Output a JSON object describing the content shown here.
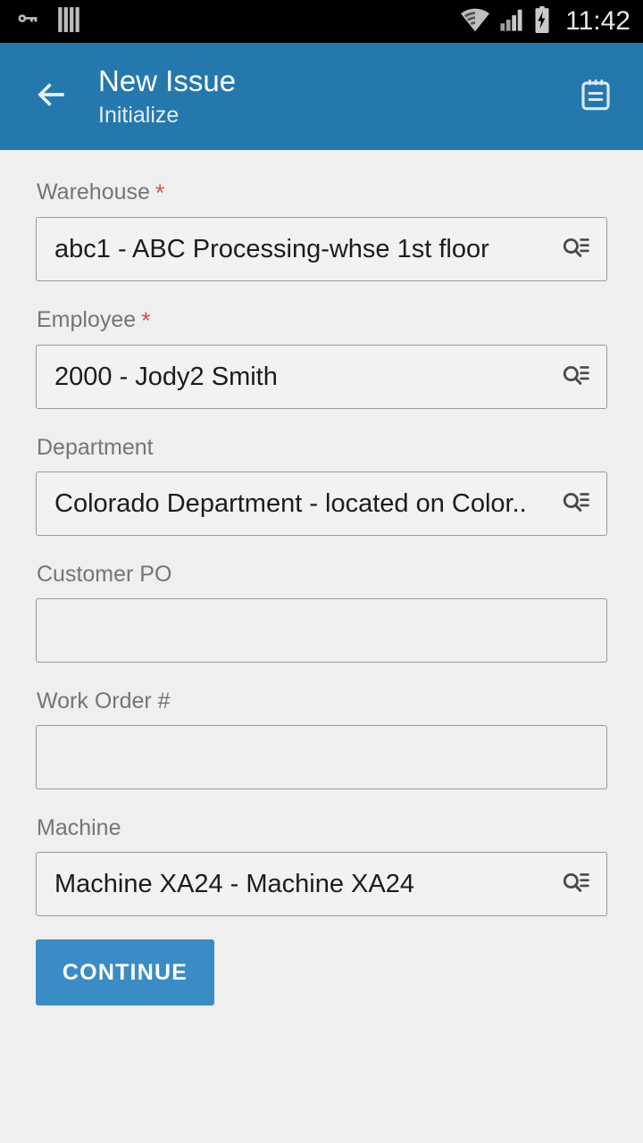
{
  "statusbar": {
    "time": "11:42",
    "left_icons": [
      "vpn-key-icon",
      "barcode-icon"
    ],
    "right_icons": [
      "wifi-icon",
      "cellular-signal-icon",
      "battery-charging-icon"
    ]
  },
  "appbar": {
    "back_icon": "arrow-left-icon",
    "title": "New Issue",
    "subtitle": "Initialize",
    "action_icon": "notepad-icon",
    "background_color": "#2578ae"
  },
  "form": {
    "fields": [
      {
        "label": "Warehouse",
        "required": true,
        "value": "abc1 - ABC Processing-whse 1st floor",
        "placeholder": "",
        "has_lookup": true,
        "name": "warehouse"
      },
      {
        "label": "Employee",
        "required": true,
        "value": "2000 - Jody2 Smith",
        "placeholder": "",
        "has_lookup": true,
        "name": "employee"
      },
      {
        "label": "Department",
        "required": false,
        "value": "Colorado Department - located on Color..",
        "placeholder": "",
        "has_lookup": true,
        "name": "department"
      },
      {
        "label": "Customer PO",
        "required": false,
        "value": "",
        "placeholder": "",
        "has_lookup": false,
        "name": "customer-po"
      },
      {
        "label": "Work Order #",
        "required": false,
        "value": "",
        "placeholder": "",
        "has_lookup": false,
        "name": "work-order-number"
      },
      {
        "label": "Machine",
        "required": false,
        "value": "Machine XA24 - Machine XA24",
        "placeholder": "",
        "has_lookup": true,
        "name": "machine"
      }
    ],
    "required_marker": "*",
    "continue_label": "CONTINUE",
    "continue_color": "#3b8cc4"
  },
  "colors": {
    "page_background": "#efefef",
    "accent": "#2578ae",
    "required_asterisk": "#d9534f",
    "label_text": "#757575",
    "value_text": "#1c1c1c"
  }
}
